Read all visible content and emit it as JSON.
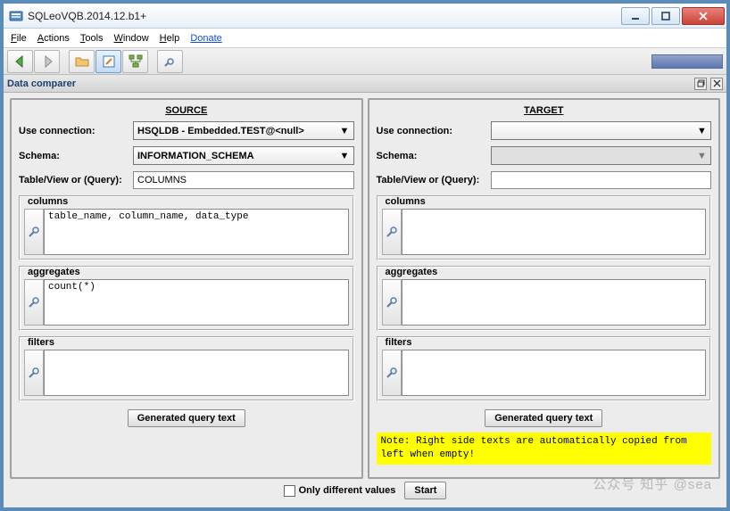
{
  "window": {
    "title": "SQLeoVQB.2014.12.b1+"
  },
  "menu": {
    "file": "File",
    "actions": "Actions",
    "tools": "Tools",
    "window": "Window",
    "help": "Help",
    "donate": "Donate"
  },
  "subwindow": {
    "title": "Data comparer"
  },
  "pane_titles": {
    "source": "SOURCE",
    "target": "TARGET"
  },
  "labels": {
    "use_connection": "Use connection:",
    "schema": "Schema:",
    "table_view": "Table/View or (Query):",
    "columns": "columns",
    "aggregates": "aggregates",
    "filters": "filters",
    "generated": "Generated query text",
    "only_diff": "Only different values",
    "start": "Start"
  },
  "source": {
    "connection": "HSQLDB - Embedded.TEST@<null>",
    "schema": "INFORMATION_SCHEMA",
    "table": "COLUMNS",
    "columns": "table_name, column_name, data_type",
    "aggregates": "count(*)",
    "filters": ""
  },
  "target": {
    "connection": "",
    "schema": "",
    "table": "",
    "columns": "",
    "aggregates": "",
    "filters": ""
  },
  "note": "Note: Right side texts are automatically copied from left when empty!",
  "watermark": "公众号 知乎 @sea"
}
